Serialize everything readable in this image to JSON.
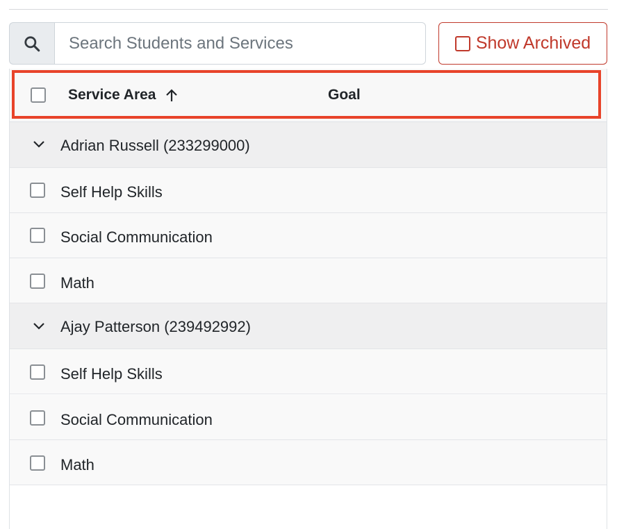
{
  "search": {
    "placeholder": "Search Students and Services"
  },
  "archived_button": {
    "label": "Show Archived"
  },
  "table": {
    "headers": {
      "service_area": "Service Area",
      "goal": "Goal"
    },
    "groups": [
      {
        "student": "Adrian Russell (233299000)",
        "services": [
          "Self Help Skills",
          "Social Communication",
          "Math"
        ]
      },
      {
        "student": "Ajay Patterson (239492992)",
        "services": [
          "Self Help Skills",
          "Social Communication",
          "Math"
        ]
      }
    ]
  },
  "colors": {
    "accent": "#c0392b",
    "highlight": "#e8432a"
  },
  "icons": {
    "search": "search-icon",
    "sort": "arrow-up-icon",
    "collapse": "chevron-down-icon"
  }
}
